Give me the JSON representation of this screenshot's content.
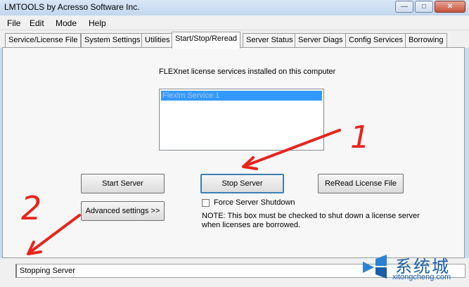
{
  "window": {
    "title": "LMTOOLS by Acresso Software Inc.",
    "controls": {
      "minimize_icon": "minimize-icon",
      "maximize_icon": "maximize-icon",
      "close_icon": "close-icon"
    }
  },
  "menubar": {
    "items": [
      "File",
      "Edit",
      "Mode",
      "Help"
    ]
  },
  "tabs": [
    {
      "label": "Service/License File"
    },
    {
      "label": "System Settings"
    },
    {
      "label": "Utilities"
    },
    {
      "label": "Start/Stop/Reread",
      "active": true
    },
    {
      "label": "Server Status"
    },
    {
      "label": "Server Diags"
    },
    {
      "label": "Config Services"
    },
    {
      "label": "Borrowing"
    }
  ],
  "panel": {
    "caption": "FLEXnet license services installed on this computer",
    "services": [
      "Flexlm Service 1"
    ],
    "selected_service_index": 0,
    "buttons": {
      "start": "Start Server",
      "stop": "Stop Server",
      "reread": "ReRead License File",
      "advanced": "Advanced settings >>"
    },
    "force_shutdown": {
      "label": "Force Server Shutdown",
      "checked": false
    },
    "note": "NOTE:  This box must be checked to shut down a license server when licenses are borrowed."
  },
  "annotations": {
    "marker_1": "1",
    "marker_2": "2",
    "color": "#e8241c"
  },
  "statusbar": {
    "text": "Stopping Server"
  },
  "watermark": {
    "logo_icon": "windows-logo-icon",
    "text_cn": "系统城",
    "url": "xitongcheng.com"
  },
  "colors": {
    "selection": "#3399ff",
    "titlebar": "#c9dbee",
    "annotation": "#e8241c"
  }
}
